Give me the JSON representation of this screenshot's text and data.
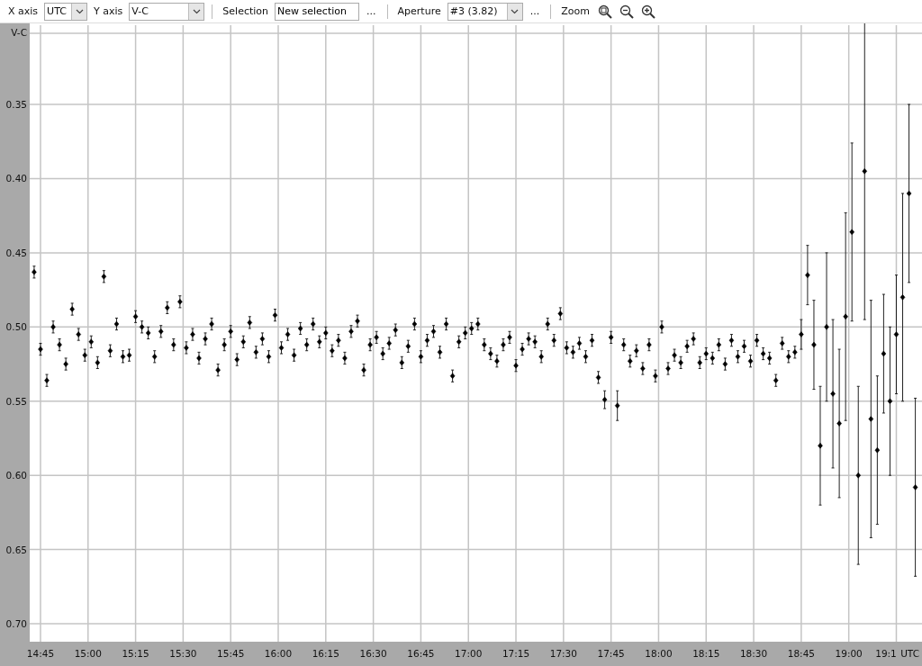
{
  "toolbar": {
    "x_axis": {
      "label": "X axis",
      "value": "UTC"
    },
    "y_axis": {
      "label": "Y axis",
      "value": "V-C"
    },
    "selection": {
      "label": "Selection",
      "value": "New selection",
      "more": "..."
    },
    "aperture": {
      "label": "Aperture",
      "value": "#3 (3.82)",
      "more": "..."
    },
    "zoom": {
      "label": "Zoom"
    }
  },
  "chart": {
    "chart_data": {
      "type": "scatter",
      "grid": true,
      "xlabel": "UTC",
      "ylabel": "V-C",
      "xlim": [
        881.6,
        1163.1
      ],
      "ylim": [
        0.7121,
        0.2966
      ],
      "xticks": [
        {
          "value": 885,
          "label": "14:45"
        },
        {
          "value": 900,
          "label": "15:00"
        },
        {
          "value": 915,
          "label": "15:15"
        },
        {
          "value": 930,
          "label": "15:30"
        },
        {
          "value": 945,
          "label": "15:45"
        },
        {
          "value": 960,
          "label": "16:00"
        },
        {
          "value": 975,
          "label": "16:15"
        },
        {
          "value": 990,
          "label": "16:30"
        },
        {
          "value": 1005,
          "label": "16:45"
        },
        {
          "value": 1020,
          "label": "17:00"
        },
        {
          "value": 1035,
          "label": "17:15"
        },
        {
          "value": 1050,
          "label": "17:30"
        },
        {
          "value": 1065,
          "label": "17:45"
        },
        {
          "value": 1080,
          "label": "18:00"
        },
        {
          "value": 1095,
          "label": "18:15"
        },
        {
          "value": 1110,
          "label": "18:30"
        },
        {
          "value": 1125,
          "label": "18:45"
        },
        {
          "value": 1140,
          "label": "19:00"
        },
        {
          "value": 1155,
          "label": "19:1"
        }
      ],
      "yticks": [
        {
          "value": 0.35,
          "label": "0.35"
        },
        {
          "value": 0.4,
          "label": "0.40"
        },
        {
          "value": 0.45,
          "label": "0.45"
        },
        {
          "value": 0.5,
          "label": "0.50"
        },
        {
          "value": 0.55,
          "label": "0.55"
        },
        {
          "value": 0.6,
          "label": "0.60"
        },
        {
          "value": 0.65,
          "label": "0.65"
        },
        {
          "value": 0.7,
          "label": "0.70"
        }
      ],
      "x": [
        883,
        885,
        887,
        889,
        891,
        893,
        895,
        897,
        899,
        901,
        903,
        905,
        907,
        909,
        911,
        913,
        915,
        917,
        919,
        921,
        923,
        925,
        927,
        929,
        931,
        933,
        935,
        937,
        939,
        941,
        943,
        945,
        947,
        949,
        951,
        953,
        955,
        957,
        959,
        961,
        963,
        965,
        967,
        969,
        971,
        973,
        975,
        977,
        979,
        981,
        983,
        985,
        987,
        989,
        991,
        993,
        995,
        997,
        999,
        1001,
        1003,
        1005,
        1007,
        1009,
        1011,
        1013,
        1015,
        1017,
        1019,
        1021,
        1023,
        1025,
        1027,
        1029,
        1031,
        1033,
        1035,
        1037,
        1039,
        1041,
        1043,
        1045,
        1047,
        1049,
        1051,
        1053,
        1055,
        1057,
        1059,
        1061,
        1063,
        1065,
        1067,
        1069,
        1071,
        1073,
        1075,
        1077,
        1079,
        1081,
        1083,
        1085,
        1087,
        1089,
        1091,
        1093,
        1095,
        1097,
        1099,
        1101,
        1103,
        1105,
        1107,
        1109,
        1111,
        1113,
        1115,
        1117,
        1119,
        1121,
        1123,
        1125,
        1127,
        1129,
        1131,
        1133,
        1135,
        1137,
        1139,
        1141,
        1143,
        1145,
        1147,
        1149,
        1151,
        1153,
        1155,
        1157,
        1159,
        1161
      ],
      "series": [
        {
          "color": "#000000",
          "values": [
            0.463,
            0.515,
            0.536,
            0.5,
            0.512,
            0.525,
            0.488,
            0.505,
            0.519,
            0.51,
            0.524,
            0.466,
            0.516,
            0.498,
            0.52,
            0.519,
            0.493,
            0.5,
            0.504,
            0.52,
            0.503,
            0.487,
            0.512,
            0.483,
            0.514,
            0.505,
            0.521,
            0.508,
            0.498,
            0.529,
            0.512,
            0.503,
            0.522,
            0.51,
            0.497,
            0.517,
            0.508,
            0.52,
            0.492,
            0.514,
            0.505,
            0.519,
            0.501,
            0.512,
            0.498,
            0.51,
            0.504,
            0.516,
            0.509,
            0.521,
            0.503,
            0.496,
            0.529,
            0.512,
            0.507,
            0.518,
            0.511,
            0.502,
            0.524,
            0.513,
            0.498,
            0.52,
            0.509,
            0.503,
            0.517,
            0.498,
            0.533,
            0.51,
            0.504,
            0.501,
            0.498,
            0.512,
            0.518,
            0.523,
            0.512,
            0.507,
            0.526,
            0.515,
            0.508,
            0.51,
            0.52,
            0.498,
            0.509,
            0.491,
            0.514,
            0.517,
            0.511,
            0.52,
            0.509,
            0.534,
            0.549,
            0.507,
            0.553,
            0.512,
            0.523,
            0.516,
            0.528,
            0.512,
            0.533,
            0.5,
            0.528,
            0.519,
            0.524,
            0.513,
            0.508,
            0.524,
            0.518,
            0.521,
            0.512,
            0.525,
            0.509,
            0.52,
            0.513,
            0.523,
            0.509,
            0.518,
            0.521,
            0.536,
            0.511,
            0.52,
            0.517,
            0.505,
            0.465,
            0.512,
            0.58,
            0.5,
            0.545,
            0.565,
            0.493,
            0.436,
            0.6,
            0.395,
            0.562,
            0.583,
            0.518,
            0.55,
            0.505,
            0.48,
            0.41,
            0.608
          ],
          "errors": [
            0.004,
            0.004,
            0.004,
            0.004,
            0.004,
            0.004,
            0.004,
            0.004,
            0.004,
            0.004,
            0.004,
            0.004,
            0.004,
            0.004,
            0.004,
            0.004,
            0.004,
            0.004,
            0.004,
            0.004,
            0.004,
            0.004,
            0.004,
            0.004,
            0.004,
            0.004,
            0.004,
            0.004,
            0.004,
            0.004,
            0.004,
            0.004,
            0.004,
            0.004,
            0.004,
            0.004,
            0.004,
            0.004,
            0.004,
            0.004,
            0.004,
            0.004,
            0.004,
            0.004,
            0.004,
            0.004,
            0.004,
            0.004,
            0.004,
            0.004,
            0.004,
            0.004,
            0.004,
            0.004,
            0.004,
            0.004,
            0.004,
            0.004,
            0.004,
            0.004,
            0.004,
            0.004,
            0.004,
            0.004,
            0.004,
            0.004,
            0.004,
            0.004,
            0.004,
            0.004,
            0.004,
            0.004,
            0.004,
            0.004,
            0.004,
            0.004,
            0.004,
            0.004,
            0.004,
            0.004,
            0.004,
            0.004,
            0.004,
            0.004,
            0.004,
            0.004,
            0.004,
            0.004,
            0.004,
            0.004,
            0.006,
            0.004,
            0.01,
            0.004,
            0.004,
            0.004,
            0.004,
            0.004,
            0.004,
            0.004,
            0.004,
            0.004,
            0.004,
            0.004,
            0.004,
            0.004,
            0.004,
            0.004,
            0.004,
            0.004,
            0.004,
            0.004,
            0.004,
            0.004,
            0.004,
            0.004,
            0.004,
            0.004,
            0.004,
            0.004,
            0.004,
            0.01,
            0.02,
            0.03,
            0.04,
            0.05,
            0.05,
            0.05,
            0.07,
            0.06,
            0.06,
            0.1,
            0.08,
            0.05,
            0.04,
            0.05,
            0.04,
            0.07,
            0.06,
            0.06
          ]
        }
      ]
    }
  }
}
